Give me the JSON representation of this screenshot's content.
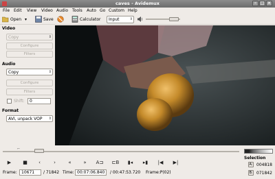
{
  "window": {
    "title": "caves - Avidemux"
  },
  "menu": [
    "File",
    "Edit",
    "View",
    "Video",
    "Audio",
    "Tools",
    "Auto",
    "Go",
    "Custom",
    "Help"
  ],
  "toolbar": {
    "open_label": "Open",
    "save_label": "Save",
    "calculator_label": "Calculator",
    "input_mode": "Input"
  },
  "sidebar": {
    "video_title": "Video",
    "video_codec": "Copy",
    "video_configure": "Configure",
    "video_filters": "Filters",
    "audio_title": "Audio",
    "audio_codec": "Copy",
    "audio_configure": "Configure",
    "audio_filters": "Filters",
    "shift_label": "Shift:",
    "shift_value": "0",
    "format_title": "Format",
    "format_value": "AVI, unpack VOP"
  },
  "timeline": {
    "position": 0.14
  },
  "controls": {
    "marker_a": "A",
    "marker_b": "B"
  },
  "status": {
    "frame_label": "Frame:",
    "frame_value": "10671",
    "total_frames": "/ 71842",
    "time_label": "Time:",
    "time_value": "00:07:06.840",
    "total_time": "/ 00:47:53.720",
    "frame_type": "Frame:P(02)"
  },
  "selection": {
    "title": "Selection",
    "a_label": "A:",
    "a_value": "004818",
    "b_label": "B:",
    "b_value": "071842"
  },
  "colors": {
    "video_bg": "#1c2224",
    "sphere": "#c48a2a",
    "window_bg": "#efebe7"
  }
}
